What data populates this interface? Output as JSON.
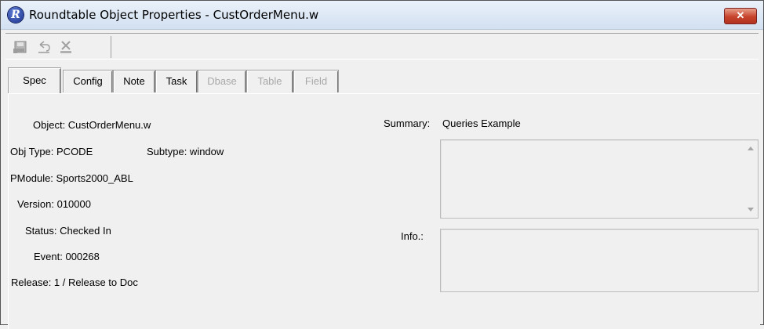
{
  "window": {
    "title": "Roundtable Object Properties - CustOrderMenu.w",
    "close_label": "✕"
  },
  "tabs": [
    {
      "label": "Spec",
      "active": true,
      "disabled": false
    },
    {
      "label": "Config",
      "active": false,
      "disabled": false
    },
    {
      "label": "Note",
      "active": false,
      "disabled": false
    },
    {
      "label": "Task",
      "active": false,
      "disabled": false
    },
    {
      "label": "Dbase",
      "active": false,
      "disabled": true
    },
    {
      "label": "Table",
      "active": false,
      "disabled": true
    },
    {
      "label": "Field",
      "active": false,
      "disabled": true
    }
  ],
  "spec": {
    "object": "Object: CustOrderMenu.w",
    "obj_type": "Obj Type: PCODE",
    "subtype": "Subtype: window",
    "pmodule": "PModule: Sports2000_ABL",
    "version": "Version: 010000",
    "status": "Status: Checked In",
    "event": "Event: 000268",
    "release": "Release: 1 / Release to Doc",
    "summary_label": "Summary:",
    "summary_value": "Queries Example",
    "info_label": "Info.:"
  },
  "icons": [
    "save-icon",
    "undo-icon",
    "delete-icon",
    "app-logo-icon"
  ],
  "colors": {
    "titlebar": "#dde8f5",
    "close": "#c7432b",
    "disabled_text": "#a8a8a8"
  }
}
